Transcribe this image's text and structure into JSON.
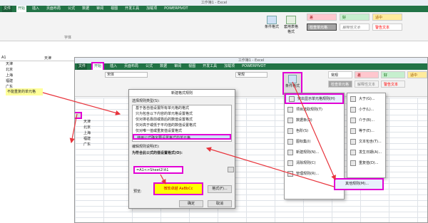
{
  "back": {
    "title": "工作簿1 - Excel",
    "tabs": [
      "文件",
      "开始",
      "插入",
      "页面布局",
      "公式",
      "数据",
      "审阅",
      "视图",
      "开发工具",
      "加载项",
      "POWERPIVOT"
    ],
    "styles": [
      "差",
      "好",
      "适中",
      "检查单元格",
      "解释性文本",
      "警告文本"
    ],
    "group": "字体",
    "cells": [
      "天津",
      "北京",
      "上海",
      "福建",
      "广东"
    ],
    "selected": "不能重复的单元格",
    "namebox": "A1",
    "formula": "天津",
    "cond_label": "条件格式",
    "table_label": "套用表格格式"
  },
  "front": {
    "title": "工作簿1 - Excel",
    "tabs": [
      "文件",
      "开始",
      "插入",
      "页面布局",
      "公式",
      "数据",
      "审阅",
      "视图",
      "开发工具",
      "加载项",
      "POWERPIVOT"
    ],
    "font": "宋体",
    "numfmt": "常规",
    "cells": [
      "天津",
      "北京",
      "上海",
      "福建",
      "广东"
    ],
    "cond_label": "条件格式",
    "styles": [
      "常规",
      "差",
      "好",
      "适中",
      "检查单元格",
      "解释性文本",
      "警告文本"
    ]
  },
  "dialog": {
    "title": "新建格式规则",
    "type_label": "选择规则类型(S):",
    "rules": [
      "基于各自值设置所有单元格的格式",
      "只为包含以下内容的单元格设置格式",
      "仅对排名靠前或靠后的数值设置格式",
      "仅对高于或低于平均值的数值设置格式",
      "仅对唯一值或重复值设置格式",
      "使用公式确定要设置格式的单元格"
    ],
    "desc_label": "编辑规则说明(E):",
    "formula_label": "为符合此公式的值设置格式(O):",
    "formula": "=A1<>Sheet2!A1",
    "preview_label": "预览:",
    "preview_text": "微软卓越 AaBbCc",
    "format_btn": "格式(F)...",
    "ok": "确定",
    "cancel": "取消"
  },
  "menu": {
    "items": [
      "突出显示单元格规则(H)",
      "项目选取规则(T)",
      "数据条(D)",
      "色阶(S)",
      "图标集(I)",
      "新建规则(N)...",
      "清除规则(C)",
      "管理规则(R)..."
    ],
    "sub": [
      "大于(G)...",
      "小于(L)...",
      "介于(B)...",
      "等于(E)...",
      "文本包含(T)...",
      "发生日期(A)...",
      "重复值(D)...",
      "其他规则(M)..."
    ]
  },
  "colors": {
    "highlight": "#e200d5",
    "excel_green": "#217346",
    "preview_yellow": "#ffff00"
  }
}
